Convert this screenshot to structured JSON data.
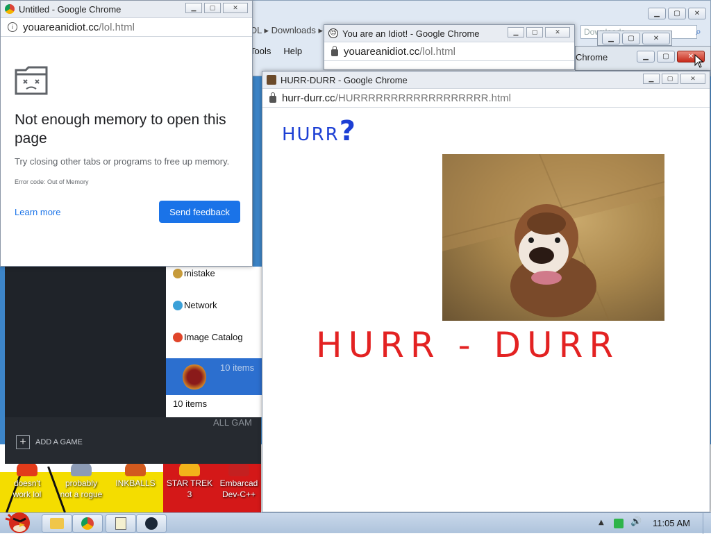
{
  "desktop": {
    "icons": [
      {
        "label_line1": "doesn't",
        "label_line2": "work lol",
        "icon": "red-app-icon"
      },
      {
        "label_line1": "probably",
        "label_line2": "not a rogue",
        "icon": "computer-icon"
      },
      {
        "label_line1": "INKBALLS",
        "label_line2": "",
        "icon": "game-icon"
      },
      {
        "label_line1": "STAR TREK",
        "label_line2": "3",
        "icon": "star-trek-icon"
      },
      {
        "label_line1": "Embarcad",
        "label_line2": "Dev-C++",
        "icon": "cpp-icon"
      }
    ]
  },
  "explorer": {
    "crumb": "OL  ▸  Downloads  ▸",
    "menu": [
      "Tools",
      "Help"
    ],
    "search_text": "Downloads",
    "right_window_title": "Chrome"
  },
  "steam": {
    "library_items": [
      {
        "label": "mistake",
        "icon": "folder-icon"
      },
      {
        "label": "Network",
        "icon": "network-icon"
      },
      {
        "label": "Image Catalog",
        "icon": "catalog-icon"
      }
    ],
    "selected_count": "10 items",
    "footer_count": "10 items",
    "all_games": "ALL GAM",
    "add_game": "ADD A GAME"
  },
  "win_error": {
    "title": "Untitled - Google Chrome",
    "url_host": "youareanidiot.cc",
    "url_path": "/lol.html",
    "heading": "Not enough memory to open this page",
    "message": "Try closing other tabs or programs to free up memory.",
    "error_code": "Error code: Out of Memory",
    "learn_more": "Learn more",
    "send_feedback": "Send feedback"
  },
  "win_idiot": {
    "title": "You are an Idiot! - Google Chrome",
    "url_host": "youareanidiot.cc",
    "url_path": "/lol.html"
  },
  "win_hurr": {
    "title": "HURR-DURR - Google Chrome",
    "url_host": "hurr-durr.cc",
    "url_path": "/HURRRRRRRRRRRRRRRRRR.html",
    "small_text": "HURR",
    "question": "?",
    "big_text": "HURR - DURR"
  },
  "taskbar": {
    "clock": "11:05 AM"
  },
  "colors": {
    "chrome_blue": "#1a73e8",
    "hurr_blue": "#1c3fd4",
    "hurr_red": "#e32222"
  }
}
